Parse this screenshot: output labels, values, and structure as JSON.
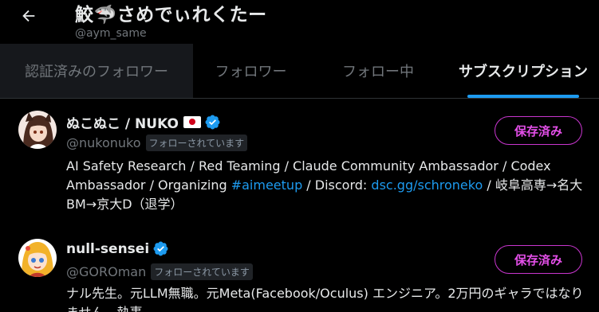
{
  "header": {
    "display_name": "鮫🦈さめでぃれくたー",
    "handle": "@aym_same"
  },
  "tabs": [
    {
      "label": "認証済みのフォロワー"
    },
    {
      "label": "フォロワー"
    },
    {
      "label": "フォロー中"
    },
    {
      "label": "サブスクリプション"
    }
  ],
  "colors": {
    "accent": "#1d9bf0",
    "subscribed": "#e34fe8",
    "background": "#000000"
  },
  "users": [
    {
      "name": "ぬこぬこ / NUKO",
      "handle": "@nukonuko",
      "follows_you": "フォローされています",
      "button": "保存済み",
      "bio": {
        "p1": "AI Safety Research / Red Teaming / Claude Community Ambassador / Codex Ambassador / Organizing ",
        "tag": "#aimeetup",
        "p2": " / Discord: ",
        "link": "dsc.gg/schroneko",
        "p3": " / 岐阜高専→名大BM→京大D（退学）"
      }
    },
    {
      "name": "null-sensei",
      "handle": "@GOROman",
      "follows_you": "フォローされています",
      "button": "保存済み",
      "bio": {
        "p1": "ナル先生。元LLM無職。元Meta(Facebook/Oculus) エンジニア。2万円のギャラではなりません。執事"
      }
    }
  ]
}
